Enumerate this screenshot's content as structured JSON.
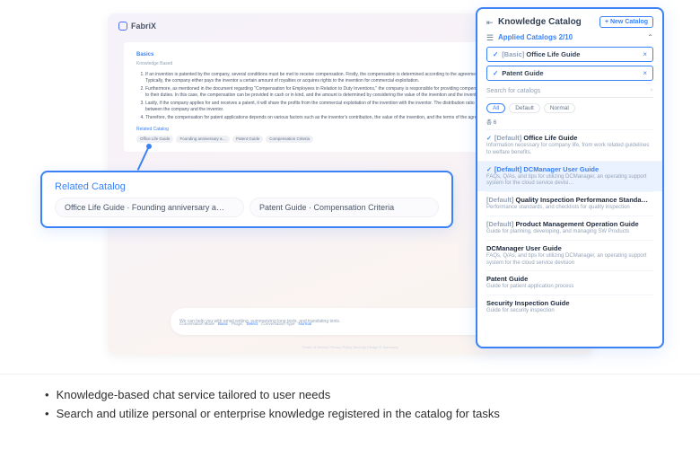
{
  "app": {
    "name": "FabriX"
  },
  "doc": {
    "title": "Basics",
    "subtitle": "Knowledge Based",
    "items": [
      "If an invention is patented by the company, several conditions must be met to receive compensation. Firstly, the compensation is determined according to the agreement between the inventor and the company. Typically, the company either pays the inventor a certain amount of royalties or acquires rights to the invention for commercial exploitation.",
      "Furthermore, as mentioned in the document regarding \"Compensation for Employees in Relation to Duty Inventions,\" the company is responsible for providing compensation to the inventor for inventions related to their duties. In this case, the compensation can be provided in cash or in kind, and the amount is determined by considering the value of the invention and the inventor's contribution.",
      "Lastly, if the company applies for and receives a patent, it will share the profits from the commercial exploitation of the invention with the inventor. The distribution ratio of the profits depends on the agreement between the company and the inventor.",
      "Therefore, the compensation for patent applications depends on various factors such as the inventor's contribution, the value of the invention, and the terms of the agreement with the company."
    ],
    "related_title": "Related Catalog",
    "chips": [
      "Office Life Guide",
      "Founding anniversary a…",
      "Patent Guide",
      "Compensation Criteria"
    ]
  },
  "input": {
    "placeholder": "We can help you with email writing, summarizing long texts, and translating texts.",
    "meta_label1": "Conversation Mode",
    "meta_val1": "Basic",
    "meta_label2": "Plugin",
    "meta_val2": "Select",
    "meta_label3": "Conversation Type",
    "meta_val3": "Normal",
    "footer": "Terms of Service   Privacy Policy   Security Pledge   © Samsung"
  },
  "callout": {
    "title": "Related Catalog",
    "pill1": "Office Life Guide · Founding anniversary a…",
    "pill2": "Patent Guide · Compensation Criteria"
  },
  "panel": {
    "title": "Knowledge Catalog",
    "new_btn": "+  New Catalog",
    "applied": "Applied Catalogs 2/10",
    "tag1_prefix": "[Basic]",
    "tag1": "Office Life Guide",
    "tag2": "Patent Guide",
    "search_ph": "Search for catalogs",
    "filters": {
      "all": "All",
      "default": "Default",
      "normal": "Normal"
    },
    "count": "총 6",
    "items": [
      {
        "pre": "[Default]",
        "title": "Office Life Guide",
        "desc": "Information necessary for company life, from work related guidelines to welfare benefits.",
        "checked": true
      },
      {
        "pre": "[Default]",
        "title": "DCManager User Guide",
        "desc": "FAQs, Q/As, and tips for utilizing DCManager, an operating support system for the cloud service devisi…",
        "checked": true,
        "selected": true
      },
      {
        "pre": "[Default]",
        "title": "Quality Inspection Performance Standa…",
        "desc": "Performance standards, and checklists for quality inspection"
      },
      {
        "pre": "[Default]",
        "title": "Product Management Operation Guide",
        "desc": "Guide for planning, developing, and managing SW Products"
      },
      {
        "pre": "",
        "title": "DCManager User Guide",
        "desc": "FAQs, Q/As, and tips for utilizing DCManager, an operating support system for the cloud service devision"
      },
      {
        "pre": "",
        "title": "Patent Guide",
        "desc": "Guide for patient application process"
      },
      {
        "pre": "",
        "title": "Security Inspection Guide",
        "desc": "Guide for security inspection"
      }
    ]
  },
  "bullets": {
    "b1": "Knowledge-based chat service tailored to user needs",
    "b2": "Search and utilize personal or enterprise knowledge registered in the catalog for tasks"
  }
}
